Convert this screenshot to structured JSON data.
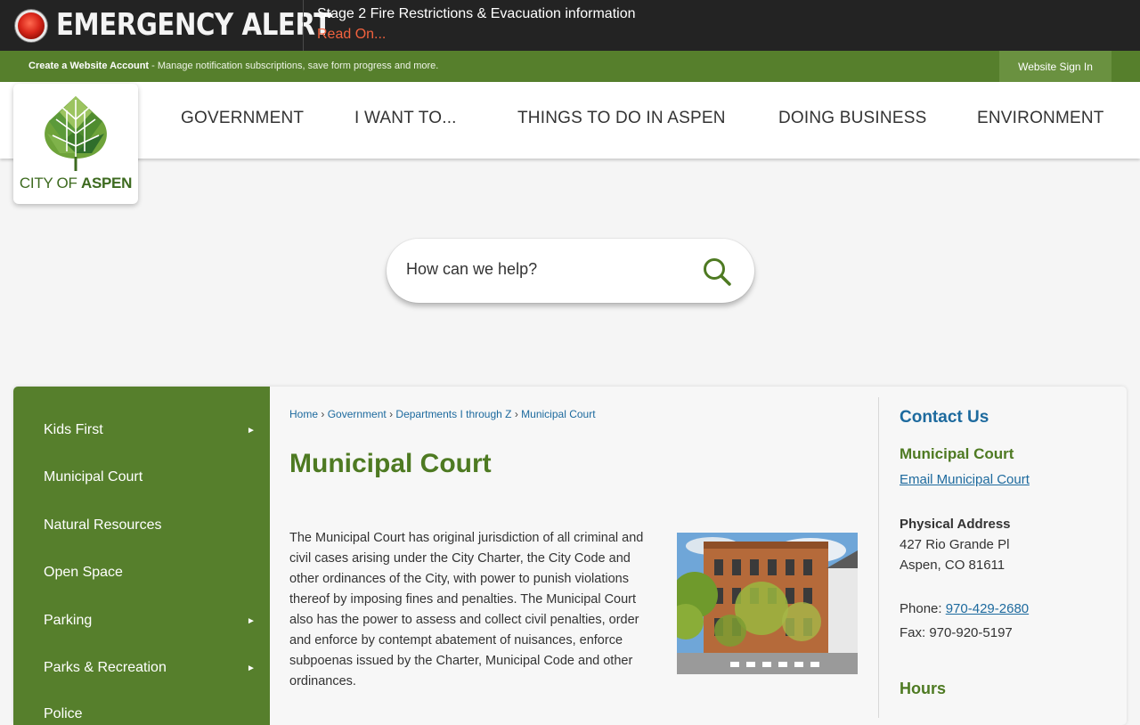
{
  "alert": {
    "title": "EMERGENCY ALERT",
    "message": "Stage 2 Fire Restrictions & Evacuation information",
    "read_on": "Read On..."
  },
  "account_bar": {
    "create_link": "Create a Website Account",
    "description": " - Manage notification subscriptions, save form progress and more.",
    "sign_in": "Website Sign In"
  },
  "logo": {
    "text_light": "CITY OF ",
    "text_bold": "ASPEN"
  },
  "nav": {
    "items": [
      "GOVERNMENT",
      "I WANT TO...",
      "THINGS TO DO IN ASPEN",
      "DOING BUSINESS",
      "ENVIRONMENT"
    ]
  },
  "search": {
    "placeholder": "How can we help?"
  },
  "side_nav": {
    "items": [
      {
        "label": "Kids First",
        "has_arrow": true
      },
      {
        "label": "Municipal Court",
        "has_arrow": false
      },
      {
        "label": "Natural Resources",
        "has_arrow": false
      },
      {
        "label": "Open Space",
        "has_arrow": false
      },
      {
        "label": "Parking",
        "has_arrow": true
      },
      {
        "label": "Parks & Recreation",
        "has_arrow": true
      },
      {
        "label": "Police",
        "has_arrow": false
      }
    ],
    "arrow_glyph": "►"
  },
  "breadcrumb": {
    "items": [
      "Home",
      "Government",
      "Departments I through Z",
      "Municipal Court"
    ],
    "separator": "›"
  },
  "page": {
    "title": "Municipal Court",
    "body": "The Municipal Court has original jurisdiction of all criminal and civil cases arising under the City Charter, the City Code and other ordinances of the City, with power to punish violations thereof by imposing fines and penalties. The Municipal Court also has the power to assess and collect civil penalties, order and enforce by contempt abatement of nuisances, enforce subpoenas issued by the Charter, Municipal Code and other ordinances."
  },
  "contact": {
    "title": "Contact Us",
    "department": "Municipal Court",
    "email_link": "Email Municipal Court",
    "address_label": "Physical Address",
    "address_line1": "427 Rio Grande Pl",
    "address_line2": "Aspen, CO 81611",
    "phone_label": "Phone: ",
    "phone": "970-429-2680",
    "fax": "Fax: 970-920-5197",
    "hours_title": "Hours"
  },
  "colors": {
    "brand_green": "#567f2c",
    "title_green": "#4e7a22",
    "link_blue": "#1d6a9e",
    "alert_orange": "#f2623e",
    "alert_bg": "#232323"
  }
}
